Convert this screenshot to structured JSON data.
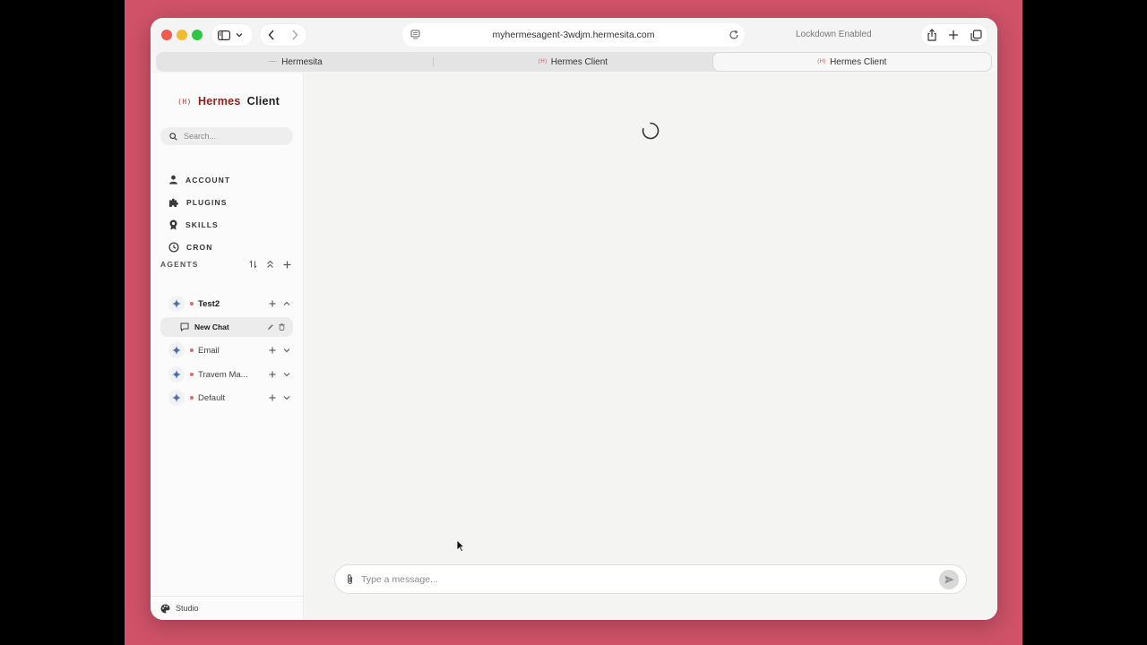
{
  "browser": {
    "url": "myhermesagent-3wdjm.hermesita.com",
    "status": "Lockdown Enabled",
    "tabs": [
      {
        "favicon": "·—·",
        "label": "Hermesita",
        "active": false
      },
      {
        "favicon": "(H)",
        "label": "Hermes Client",
        "active": false
      },
      {
        "favicon": "(H)",
        "label": "Hermes Client",
        "active": true
      }
    ]
  },
  "sidebar": {
    "brand": {
      "logo": "(H)",
      "name_part1": "Hermes",
      "name_part2": "Client"
    },
    "search_placeholder": "Search...",
    "nav": [
      {
        "label": "ACCOUNT",
        "icon": "user-icon"
      },
      {
        "label": "PLUGINS",
        "icon": "puzzle-icon"
      },
      {
        "label": "SKILLS",
        "icon": "badge-icon"
      },
      {
        "label": "CRON",
        "icon": "clock-icon"
      }
    ],
    "agents_header": "AGENTS",
    "agents": [
      {
        "name": "Test2",
        "expanded": true
      },
      {
        "name": "Email",
        "expanded": false
      },
      {
        "name": "Travem Ma...",
        "expanded": false
      },
      {
        "name": "Default",
        "expanded": false
      }
    ],
    "chat": {
      "label": "New Chat"
    },
    "footer_label": "Studio"
  },
  "composer": {
    "placeholder": "Type a message..."
  },
  "colors": {
    "accent": "#8f1e1e",
    "backdrop": "#cf5268",
    "status_dot": "#dc6b6b"
  }
}
